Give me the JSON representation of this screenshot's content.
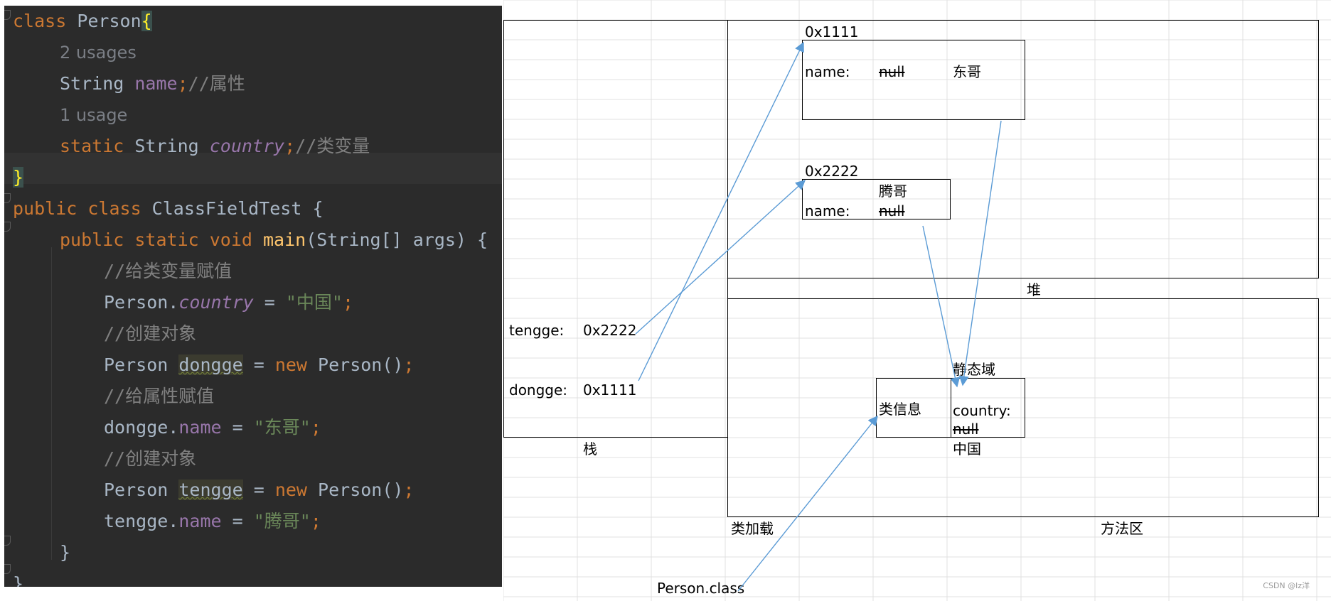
{
  "editor": {
    "lines": [
      {
        "parts": [
          [
            "kw",
            "class "
          ],
          [
            "pl",
            "Person"
          ],
          [
            "bh",
            "{"
          ]
        ]
      },
      {
        "parts": [
          [
            "hint",
            "2 usages"
          ]
        ]
      },
      {
        "parts": [
          [
            "pl",
            "String "
          ],
          [
            "fld",
            "name"
          ],
          [
            "kw",
            ";"
          ],
          [
            "cmt",
            "//属性"
          ]
        ]
      },
      {
        "parts": [
          [
            "hint",
            "1 usage"
          ]
        ]
      },
      {
        "parts": [
          [
            "kw",
            "static "
          ],
          [
            "pl",
            "String "
          ],
          [
            "fldi",
            "country"
          ],
          [
            "kw",
            ";"
          ],
          [
            "cmt",
            "//类变量"
          ]
        ]
      },
      {
        "parts": [
          [
            "bs",
            "}"
          ]
        ]
      },
      {
        "parts": [
          [
            "kw",
            "public class "
          ],
          [
            "pl",
            "ClassFieldTest {"
          ]
        ]
      },
      {
        "parts": [
          [
            "kw",
            "public static void "
          ],
          [
            "fn",
            "main"
          ],
          [
            "pl",
            "(String[] args) {"
          ]
        ]
      },
      {
        "parts": [
          [
            "cmt",
            "//给类变量赋值"
          ]
        ]
      },
      {
        "parts": [
          [
            "pl",
            "Person."
          ],
          [
            "fldi",
            "country"
          ],
          [
            "pl",
            " = "
          ],
          [
            "str",
            "\"中国\""
          ],
          [
            "kw",
            ";"
          ]
        ]
      },
      {
        "parts": [
          [
            "cmt",
            "//创建对象"
          ]
        ]
      },
      {
        "parts": [
          [
            "pl",
            "Person "
          ],
          [
            "var",
            "dongge"
          ],
          [
            "pl",
            " = "
          ],
          [
            "kw",
            "new "
          ],
          [
            "pl",
            "Person()"
          ],
          [
            "kw",
            ";"
          ]
        ]
      },
      {
        "parts": [
          [
            "cmt",
            "//给属性赋值"
          ]
        ]
      },
      {
        "parts": [
          [
            "pl",
            "dongge."
          ],
          [
            "fld",
            "name"
          ],
          [
            "pl",
            " = "
          ],
          [
            "str",
            "\"东哥\""
          ],
          [
            "kw",
            ";"
          ]
        ]
      },
      {
        "parts": [
          [
            "cmt",
            "//创建对象"
          ]
        ]
      },
      {
        "parts": [
          [
            "pl",
            "Person "
          ],
          [
            "var",
            "tengge"
          ],
          [
            "pl",
            " = "
          ],
          [
            "kw",
            "new "
          ],
          [
            "pl",
            "Person()"
          ],
          [
            "kw",
            ";"
          ]
        ]
      },
      {
        "parts": [
          [
            "pl",
            "tengge."
          ],
          [
            "fld",
            "name"
          ],
          [
            "pl",
            " = "
          ],
          [
            "str",
            "\"腾哥\""
          ],
          [
            "kw",
            ";"
          ]
        ]
      },
      {
        "parts": [
          [
            "pl",
            "}"
          ]
        ]
      },
      {
        "parts": [
          [
            "pl",
            "}"
          ]
        ]
      }
    ]
  },
  "diagram": {
    "heap_obj1_addr": "0x1111",
    "heap_obj1_field": "name:",
    "heap_obj1_old": "null",
    "heap_obj1_new": "东哥",
    "heap_obj2_addr": "0x2222",
    "heap_obj2_new": "腾哥",
    "heap_obj2_field": "name:",
    "heap_obj2_old": "null",
    "heap_label": "堆",
    "static_area_label": "静态域",
    "class_info_label": "类信息",
    "static_field": "country:",
    "static_old": "null",
    "static_new": "中国",
    "stack_var1_name": "tengge:",
    "stack_var1_val": "0x2222",
    "stack_var2_name": "dongge:",
    "stack_var2_val": "0x1111",
    "stack_label": "栈",
    "class_loading_label": "类加载",
    "method_area_label": "方法区",
    "class_file_label": "Person.class",
    "arrow_color": "#5b9bd5"
  },
  "watermark": "CSDN @lz洋"
}
